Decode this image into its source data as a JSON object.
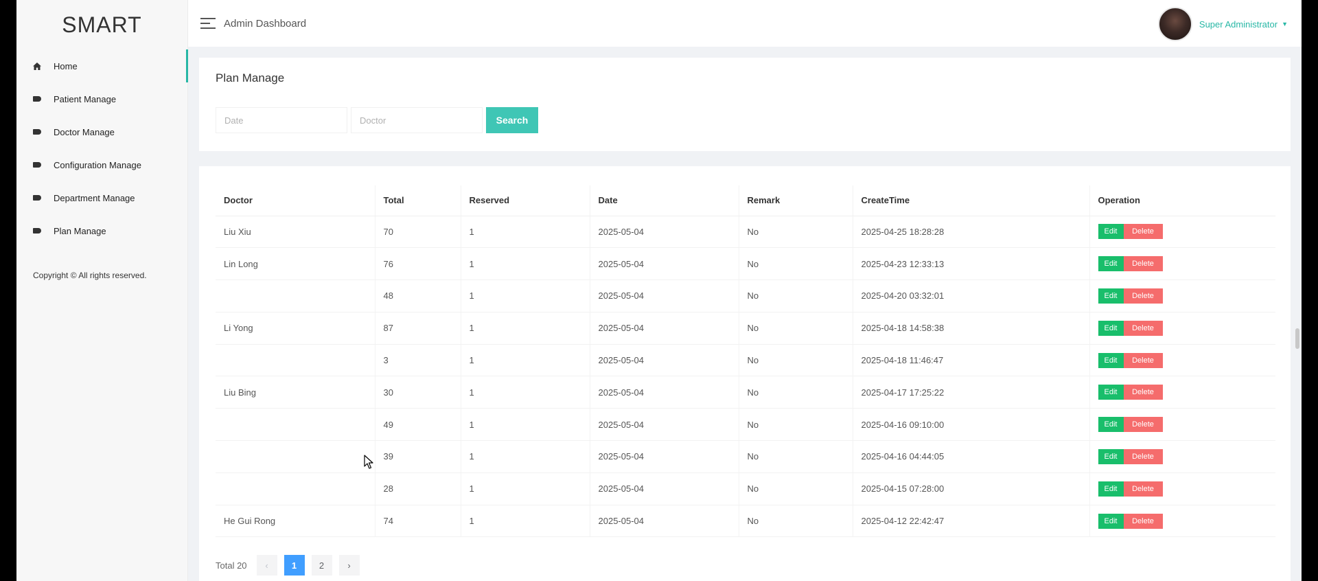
{
  "sidebar": {
    "logo": "SMART",
    "items": [
      {
        "label": "Home",
        "icon": "home-icon"
      },
      {
        "label": "Patient Manage",
        "icon": "tag-icon"
      },
      {
        "label": "Doctor Manage",
        "icon": "tag-icon"
      },
      {
        "label": "Configuration Manage",
        "icon": "tag-icon"
      },
      {
        "label": "Department Manage",
        "icon": "tag-icon"
      },
      {
        "label": "Plan Manage",
        "icon": "tag-icon"
      }
    ],
    "copyright": "Copyright © All rights reserved."
  },
  "header": {
    "breadcrumb": "Admin Dashboard",
    "user_name": "Super Administrator",
    "caret": "▼"
  },
  "search": {
    "title": "Plan Manage",
    "date_placeholder": "Date",
    "doctor_placeholder": "Doctor",
    "search_label": "Search"
  },
  "table": {
    "columns": [
      "Doctor",
      "Total",
      "Reserved",
      "Date",
      "Remark",
      "CreateTime",
      "Operation"
    ],
    "rows": [
      {
        "doctor": "Liu Xiu",
        "total": "70",
        "reserved": "1",
        "date": "2025-05-04",
        "remark": "No",
        "create_time": "2025-04-25 18:28:28"
      },
      {
        "doctor": "Lin Long",
        "total": "76",
        "reserved": "1",
        "date": "2025-05-04",
        "remark": "No",
        "create_time": "2025-04-23 12:33:13"
      },
      {
        "doctor": "",
        "total": "48",
        "reserved": "1",
        "date": "2025-05-04",
        "remark": "No",
        "create_time": "2025-04-20 03:32:01"
      },
      {
        "doctor": "Li Yong",
        "total": "87",
        "reserved": "1",
        "date": "2025-05-04",
        "remark": "No",
        "create_time": "2025-04-18 14:58:38"
      },
      {
        "doctor": "",
        "total": "3",
        "reserved": "1",
        "date": "2025-05-04",
        "remark": "No",
        "create_time": "2025-04-18 11:46:47"
      },
      {
        "doctor": "Liu Bing",
        "total": "30",
        "reserved": "1",
        "date": "2025-05-04",
        "remark": "No",
        "create_time": "2025-04-17 17:25:22"
      },
      {
        "doctor": "",
        "total": "49",
        "reserved": "1",
        "date": "2025-05-04",
        "remark": "No",
        "create_time": "2025-04-16 09:10:00"
      },
      {
        "doctor": "",
        "total": "39",
        "reserved": "1",
        "date": "2025-05-04",
        "remark": "No",
        "create_time": "2025-04-16 04:44:05"
      },
      {
        "doctor": "",
        "total": "28",
        "reserved": "1",
        "date": "2025-05-04",
        "remark": "No",
        "create_time": "2025-04-15 07:28:00"
      },
      {
        "doctor": "He Gui Rong",
        "total": "74",
        "reserved": "1",
        "date": "2025-05-04",
        "remark": "No",
        "create_time": "2025-04-12 22:42:47"
      }
    ],
    "edit_label": "Edit",
    "delete_label": "Delete"
  },
  "pagination": {
    "total_label": "Total 20",
    "prev": "‹",
    "pages": [
      "1",
      "2"
    ],
    "current": "1",
    "next": "›"
  },
  "colors": {
    "accent": "#27b7a5",
    "search_button": "#3fc6b5",
    "edit": "#19be6b",
    "delete": "#f56c6c",
    "page_active": "#409eff"
  }
}
